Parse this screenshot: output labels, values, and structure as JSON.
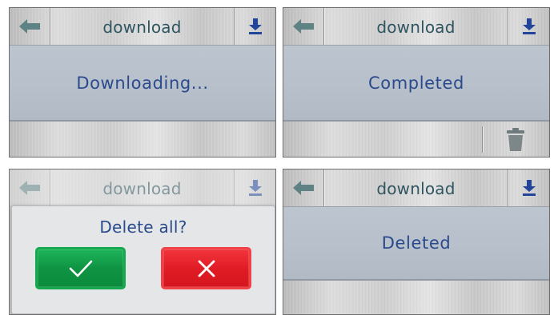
{
  "screens": [
    {
      "header": {
        "title": "download",
        "back_icon": "arrow-left-icon",
        "download_icon": "download-icon"
      },
      "status": "Downloading..."
    },
    {
      "header": {
        "title": "download",
        "back_icon": "arrow-left-icon",
        "download_icon": "download-icon"
      },
      "status": "Completed",
      "footer": {
        "trash_icon": "trash-icon"
      }
    },
    {
      "header": {
        "title": "download",
        "back_icon": "arrow-left-icon",
        "download_icon": "download-icon"
      },
      "dialog": {
        "title": "Delete all?",
        "confirm_icon": "check-icon",
        "cancel_icon": "x-icon"
      }
    },
    {
      "header": {
        "title": "download",
        "back_icon": "arrow-left-icon",
        "download_icon": "download-icon"
      },
      "status": "Deleted"
    }
  ],
  "colors": {
    "title_text": "#2f5560",
    "status_text": "#2a4a8c",
    "status_bg": "#b7bfca",
    "download_icon": "#22459a",
    "back_icon": "#5f8285",
    "confirm_button": "#0f9444",
    "cancel_button": "#df1b24"
  }
}
